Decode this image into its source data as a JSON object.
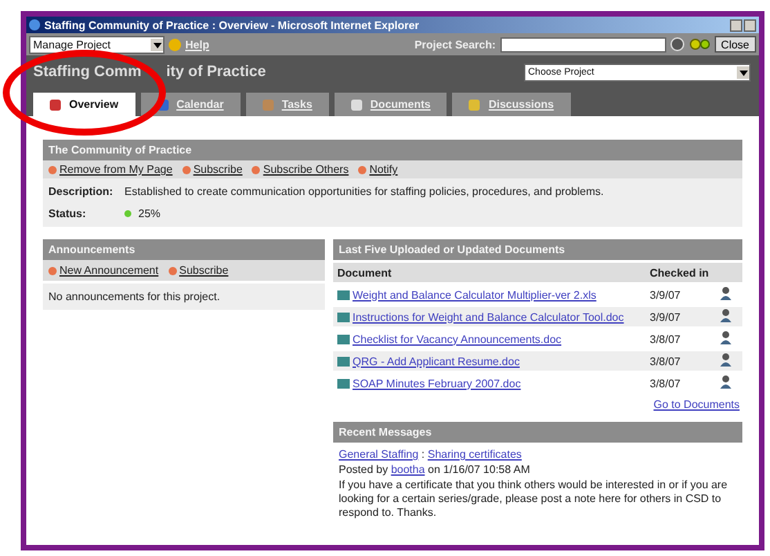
{
  "window": {
    "title": "Staffing Community of Practice : Overview - Microsoft Internet Explorer"
  },
  "toolbar": {
    "project_menu": "Manage Project",
    "help": "Help",
    "search_label": "Project Search:",
    "close": "Close"
  },
  "header": {
    "title_parts": [
      "Staffing Comm",
      "ity of Practice"
    ],
    "project_select": "Choose Project"
  },
  "tabs": [
    {
      "label": "Overview",
      "selected": true
    },
    {
      "label": "Calendar",
      "selected": false
    },
    {
      "label": "Tasks",
      "selected": false
    },
    {
      "label": "Documents",
      "selected": false
    },
    {
      "label": "Discussions",
      "selected": false
    }
  ],
  "community": {
    "title": "The Community of Practice",
    "actions": [
      "Remove from My Page",
      "Subscribe",
      "Subscribe Others",
      "Notify"
    ],
    "description_label": "Description:",
    "description": "Established to create communication opportunities for staffing policies, procedures, and problems.",
    "status_label": "Status:",
    "status": "25%"
  },
  "announcements": {
    "title": "Announcements",
    "actions": [
      "New Announcement",
      "Subscribe"
    ],
    "empty": "No announcements for this project."
  },
  "documents": {
    "title": "Last Five Uploaded or Updated Documents",
    "columns": [
      "Document",
      "Checked in"
    ],
    "rows": [
      {
        "name": "Weight and Balance Calculator  Multiplier-ver 2.xls",
        "date": "3/9/07"
      },
      {
        "name": "Instructions for Weight and Balance Calculator Tool.doc",
        "date": "3/9/07"
      },
      {
        "name": "Checklist for Vacancy Announcements.doc",
        "date": "3/8/07"
      },
      {
        "name": "QRG - Add Applicant Resume.doc",
        "date": "3/8/07"
      },
      {
        "name": "SOAP Minutes February 2007.doc",
        "date": "3/8/07"
      }
    ],
    "link": "Go to Documents"
  },
  "messages": {
    "title": "Recent Messages",
    "forum": "General Staffing",
    "separator": ":",
    "topic": "Sharing certificates",
    "posted_by": "Posted by",
    "author": "bootha",
    "posted_on": "on 1/16/07 10:58 AM",
    "body": "If you have a certificate that you think others would be interested in or if you are looking for a certain series/grade, please post a note here for others in CSD to respond to. Thanks."
  }
}
